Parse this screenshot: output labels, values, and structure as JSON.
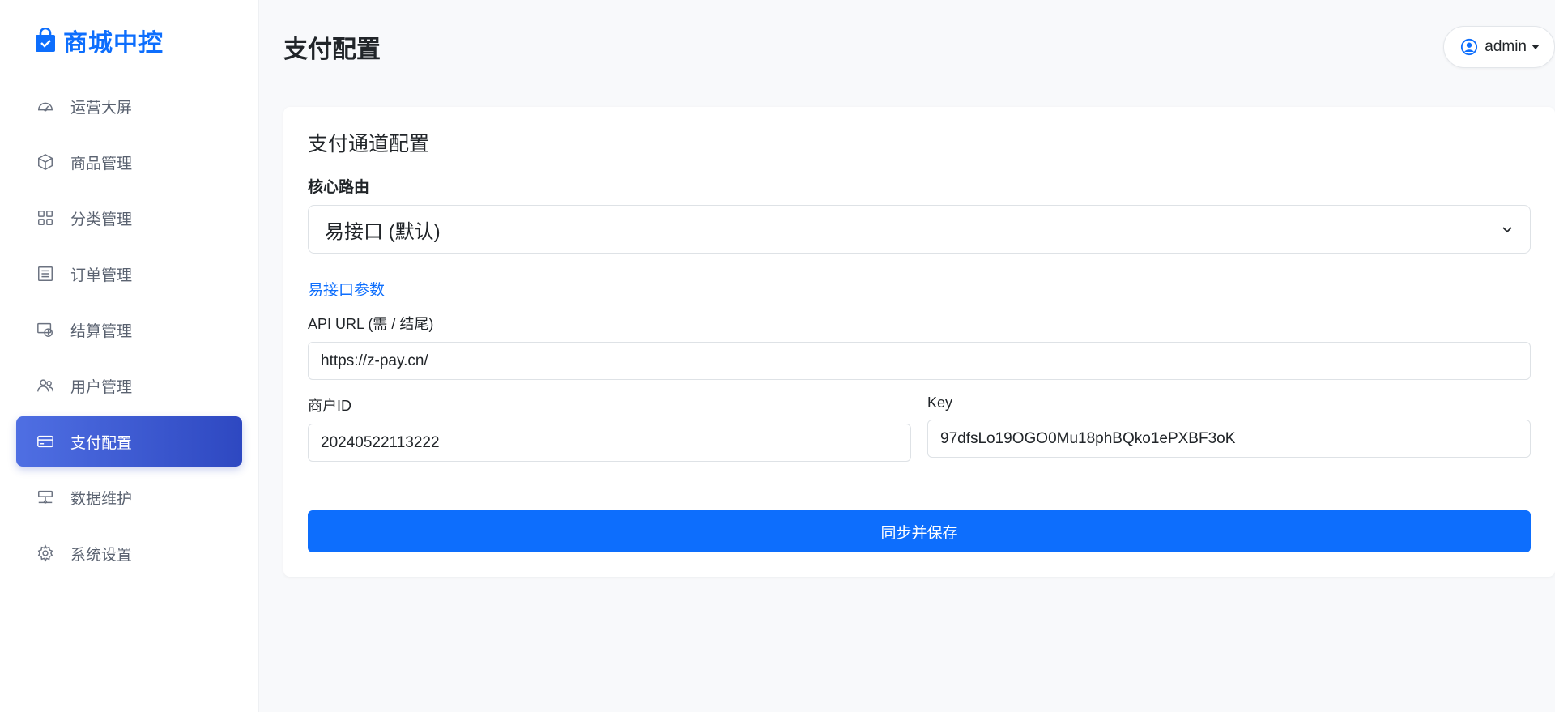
{
  "brand": {
    "name": "商城中控",
    "accent": "#0d6efd"
  },
  "sidebar": {
    "items": [
      {
        "label": "运营大屏",
        "icon": "gauge-icon"
      },
      {
        "label": "商品管理",
        "icon": "box-icon"
      },
      {
        "label": "分类管理",
        "icon": "grid-icon"
      },
      {
        "label": "订单管理",
        "icon": "list-icon"
      },
      {
        "label": "结算管理",
        "icon": "cash-icon"
      },
      {
        "label": "用户管理",
        "icon": "users-icon"
      },
      {
        "label": "支付配置",
        "icon": "credit-card-icon",
        "active": true
      },
      {
        "label": "数据维护",
        "icon": "hdd-network-icon"
      },
      {
        "label": "系统设置",
        "icon": "gear-icon"
      }
    ],
    "active_color": "#3a56d4"
  },
  "header": {
    "title": "支付配置",
    "user": "admin"
  },
  "card": {
    "title": "支付通道配置",
    "route_label": "核心路由",
    "route_value": "易接口 (默认)",
    "section_link": "易接口参数",
    "api_url_label": "API URL (需 / 结尾)",
    "api_url_value": "https://z-pay.cn/",
    "merchant_label": "商户ID",
    "merchant_value": "20240522113222",
    "key_label": "Key",
    "key_value": "97dfsLo19OGO0Mu18phBQko1ePXBF3oK",
    "save_label": "同步并保存"
  }
}
